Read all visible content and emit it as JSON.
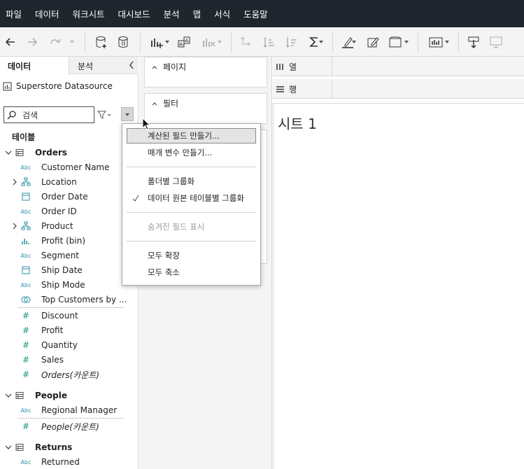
{
  "menubar": {
    "items": [
      "파일",
      "데이터",
      "워크시트",
      "대시보드",
      "분석",
      "맵",
      "서식",
      "도움말"
    ]
  },
  "left_panel": {
    "tab_data": "데이터",
    "tab_analysis": "분석",
    "datasource": "Superstore Datasource",
    "search_placeholder": "검색",
    "tables_header": "테이블",
    "orders": {
      "name": "Orders",
      "fields": [
        {
          "type": "Abc",
          "label": "Customer Name"
        },
        {
          "type": "geo",
          "label": "Location",
          "expandable": true
        },
        {
          "type": "date",
          "label": "Order Date"
        },
        {
          "type": "Abc",
          "label": "Order ID"
        },
        {
          "type": "hier",
          "label": "Product",
          "expandable": true
        },
        {
          "type": "bin",
          "label": "Profit (bin)"
        },
        {
          "type": "Abc",
          "label": "Segment"
        },
        {
          "type": "date",
          "label": "Ship Date"
        },
        {
          "type": "Abc",
          "label": "Ship Mode"
        },
        {
          "type": "set",
          "label": "Top Customers by ..."
        },
        {
          "type": "#",
          "label": "Discount"
        },
        {
          "type": "#",
          "label": "Profit"
        },
        {
          "type": "#",
          "label": "Quantity"
        },
        {
          "type": "#",
          "label": "Sales"
        },
        {
          "type": "#",
          "label": "Orders(카운트)",
          "italic": true
        }
      ]
    },
    "people": {
      "name": "People",
      "fields": [
        {
          "type": "Abc",
          "label": "Regional Manager"
        },
        {
          "type": "#",
          "label": "People(카운트)",
          "italic": true
        }
      ]
    },
    "returns": {
      "name": "Returns",
      "fields": [
        {
          "type": "Abc",
          "label": "Returned"
        }
      ]
    }
  },
  "cards": {
    "pages": "페이지",
    "filters": "필터"
  },
  "shelves": {
    "columns": "열",
    "rows": "행"
  },
  "sheet": {
    "title": "시트 1"
  },
  "context_menu": {
    "items": [
      {
        "label": "계산된 필드 만들기...",
        "highlighted": true
      },
      {
        "label": "매개 변수 만들기..."
      },
      {
        "label": "폴더별 그룹화"
      },
      {
        "label": "데이터 원본 테이블별 그룹화",
        "checked": true
      },
      {
        "label": "숨겨진 필드 표시",
        "disabled": true
      },
      {
        "label": "모두 확장"
      },
      {
        "label": "모두 축소"
      }
    ]
  },
  "colors": {
    "menubar_bg": "#1f262d",
    "dimension_icon": "#2e8fa8",
    "measure_icon": "#1d9a8c"
  }
}
